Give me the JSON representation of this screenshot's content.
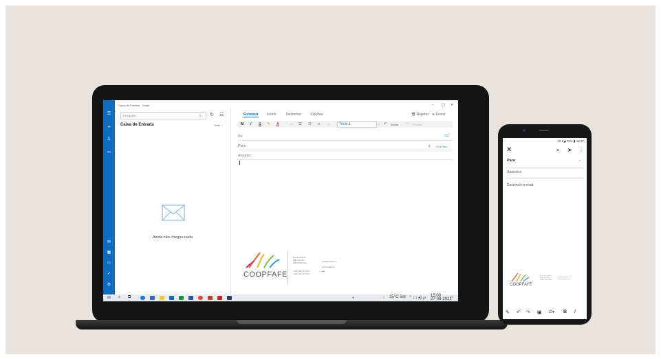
{
  "laptop": {
    "window_title": "Caixa de Entrada - Gmail",
    "window_controls": {
      "minimize": "–",
      "maximize": "▢",
      "close": "✕"
    },
    "search_placeholder": "Pesquisa",
    "inbox_title": "Caixa de Entrada",
    "filter_label": "Tudo ⌵",
    "empty_message": "Ainda não chegou nada",
    "compose_tabs": [
      "Formatar",
      "Inserir",
      "Desenhar",
      "Opções"
    ],
    "discard_label": "Rejeitar",
    "send_label": "Enviar",
    "format_toolbar": {
      "bold": "N",
      "italic": "I",
      "underline": "S",
      "style_select": "Título 1",
      "undo": "Anular",
      "redo": "Refazer"
    },
    "fields": {
      "from": "De:",
      "to": "Para:",
      "cc_bcc": "Cc e Bcc",
      "subject": "Assunto"
    },
    "signature": {
      "brand": "COOPFAFE",
      "address_lines": [
        "Rua da Cortinha",
        "4890-163 Fafe",
        "9999 PORTUGAL"
      ],
      "phone_lines": [
        "(+351) 253 XXX XXX",
        "(+351) 9XX XXX XXX"
      ],
      "contact_lines": [
        "geral@coopfafe.pt",
        "www.coopfafe.pt"
      ]
    },
    "tray": {
      "weather": "25°C Sol",
      "time": "15:00",
      "date": "27-08-2021"
    }
  },
  "phone": {
    "status": "⚙ ▾◢ 73% ▮ 15:37",
    "to_label": "Para",
    "subject_placeholder": "Assunto",
    "body_placeholder": "Escrever e-mail",
    "signature_brand": "COOPFAFE",
    "font_size": "12"
  },
  "colors": {
    "outlook_blue": "#0f6cbd",
    "backdrop": "#e8e4dd",
    "device_frame": "#141414"
  }
}
